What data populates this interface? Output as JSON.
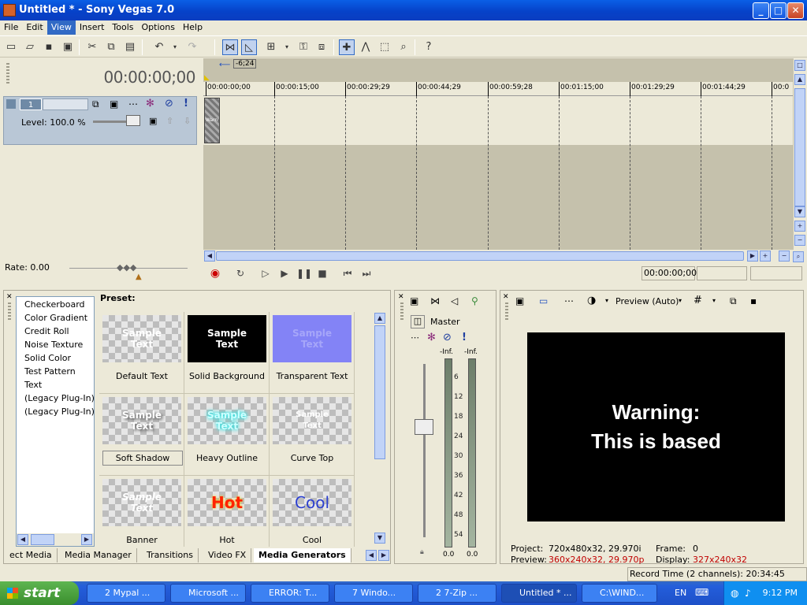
{
  "window": {
    "title": "Untitled * - Sony Vegas 7.0",
    "btn_min": "_",
    "btn_max": "□",
    "btn_close": "✕"
  },
  "menu": [
    "File",
    "Edit",
    "View",
    "Insert",
    "Tools",
    "Options",
    "Help"
  ],
  "toolbar": {
    "marker_label": "-6;24"
  },
  "timeline": {
    "timecode": "00:00:00;00",
    "ruler": [
      "00:00:00;00",
      "00:00:15;00",
      "00:00:29;29",
      "00:00:44;29",
      "00:00:59;28",
      "00:01:15;00",
      "00:01:29;29",
      "00:01:44;29",
      "00:0"
    ],
    "track_number": "1",
    "level": "Level: 100.0 %",
    "clip_label": "Warn"
  },
  "rate": "Rate: 0.00",
  "transport": {
    "timecode": "00:00:00;00"
  },
  "media_generators": {
    "items": [
      "Checkerboard",
      "Color Gradient",
      "Credit Roll",
      "Noise Texture",
      "Solid Color",
      "Test Pattern",
      "Text",
      "(Legacy Plug-In) T",
      "(Legacy Plug-In) V"
    ],
    "preset_label": "Preset:",
    "presets": [
      {
        "thumb": "Sample\nText",
        "name": "Default Text"
      },
      {
        "thumb": "Sample\nText",
        "name": "Solid Background"
      },
      {
        "thumb": "Sample\nText",
        "name": "Transparent Text"
      },
      {
        "thumb": "Sample\nText",
        "name": "Soft Shadow"
      },
      {
        "thumb": "Sample\nText",
        "name": "Heavy Outline"
      },
      {
        "thumb": "Sample\nText",
        "name": "Curve Top"
      },
      {
        "thumb": "Sample\nText",
        "name": "Banner"
      },
      {
        "thumb": "Hot",
        "name": "Hot"
      },
      {
        "thumb": "Cool",
        "name": "Cool"
      }
    ]
  },
  "tabs": [
    "ect Media",
    "Media Manager",
    "Transitions",
    "Video FX",
    "Media Generators"
  ],
  "mixer": {
    "title": "Master",
    "left_peak": "-Inf.",
    "right_peak": "-Inf.",
    "scale": [
      "6",
      "12",
      "18",
      "24",
      "30",
      "36",
      "42",
      "48",
      "54"
    ],
    "left_val": "0.0",
    "right_val": "0.0"
  },
  "preview": {
    "mode": "Preview (Auto)",
    "screen_text": "Warning:\nThis is based",
    "project_label": "Project:",
    "project_value": "720x480x32, 29.970i",
    "preview_label": "Preview:",
    "preview_value": "360x240x32, 29.970p",
    "frame_label": "Frame:",
    "frame_value": "0",
    "display_label": "Display:",
    "display_value": "327x240x32"
  },
  "record_time": "Record Time (2 channels): 20:34:45",
  "taskbar": {
    "start": "start",
    "tasks": [
      "2 Mypal ...",
      "Microsoft ...",
      "ERROR: T...",
      "7 Windo...",
      "2 7-Zip ...",
      "Untitled * ...",
      "C:\\WIND..."
    ],
    "lang": "EN",
    "clock": "9:12 PM"
  },
  "colors": {
    "accent": "#316ac5",
    "track": "#b9c7d6",
    "hot": "#ff2200",
    "cool": "#2b3fd0"
  }
}
